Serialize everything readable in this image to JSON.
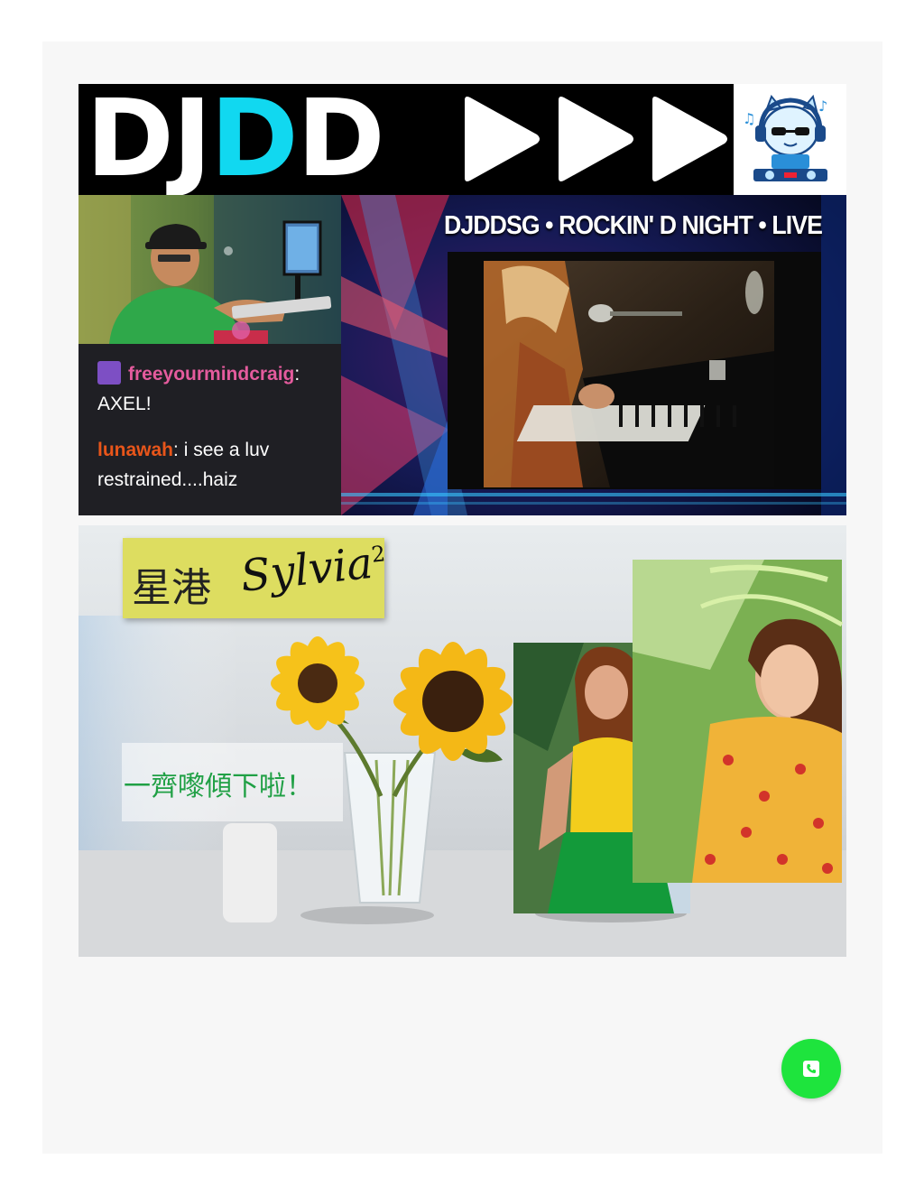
{
  "banner_dj": {
    "logo_prefix": "DJ",
    "logo_accent": "D",
    "logo_suffix": "D",
    "accent_color": "#11d8f0",
    "fast_forward_icon": "triple-play-arrow-icon",
    "mascot_icon": "cat-dj-mascot-icon",
    "stream_title": "DJDDSG • ROCKIN' D NIGHT • LIVE",
    "chat": [
      {
        "user": "freeyourmindcraig",
        "separator": ":",
        "message": "AXEL!",
        "user_color": "#e45b9d",
        "badge": true
      },
      {
        "user": "lunawah",
        "separator": ":",
        "message": " i see a luv",
        "continuation": "restrained....haiz",
        "user_color": "#e8551a",
        "badge": false
      }
    ]
  },
  "banner_sylvia": {
    "title_cjk": "星港",
    "title_script": "Sylvia",
    "title_superscript": "2",
    "title_bg_color": "#dddd60",
    "tagline": "一齊嚟傾下啦！",
    "tagline_color": "#20a045"
  },
  "contact": {
    "phone_button_icon": "phone-icon",
    "color": "#1ee43d"
  }
}
